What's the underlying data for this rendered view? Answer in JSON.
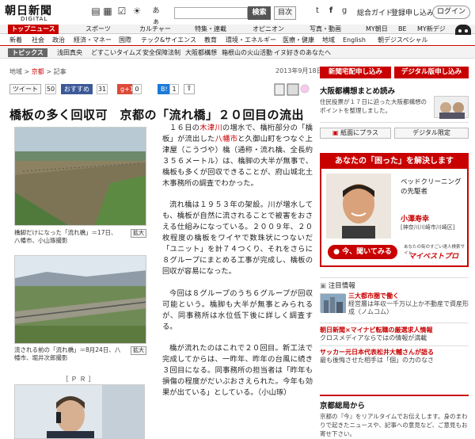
{
  "header": {
    "logo_main": "朝日新聞",
    "logo_sub": "DIGITAL",
    "search_button": "検索",
    "index_button": "目次",
    "guide_link": "総合ガイド",
    "register_link": "登録申し込み",
    "login_button": "ログイン",
    "font_size_label": "あぁ"
  },
  "nav1": {
    "items": [
      "トップニュース",
      "スポーツ",
      "カルチャー",
      "特集・連載",
      "オピニオン",
      "写真・動画",
      "MY朝日",
      "BE",
      "MY新デジ"
    ]
  },
  "nav2": {
    "items": [
      "新着",
      "社会",
      "政治",
      "経済・マネー",
      "国際",
      "テック&サイエンス",
      "教育",
      "環境・エネルギー",
      "医療・健康",
      "地域",
      "English",
      "朝デジスペシャル"
    ]
  },
  "topics": {
    "label": "トピックス",
    "items": [
      "浅田真央",
      "どすこいタイムズ",
      "安全保障法制",
      "大阪都構想",
      "箱根山の火山活動",
      "イヌ好きのあなたへ"
    ]
  },
  "breadcrumb": {
    "a": "地域",
    "b": "京都",
    "c": "記事",
    "sep": ">"
  },
  "date": "2013年9月18日",
  "social": {
    "tweet": "ツイート",
    "tweet_count": "50",
    "like": "おすすめ",
    "like_count": "31",
    "gplus": "g+1",
    "gplus_count": "0",
    "b": "B!",
    "b_count": "1"
  },
  "article": {
    "title": "橋板の多く回収可　京都の「流れ橋」２０回目の流出",
    "caption1": "橋脚だけになった「流れ橋」＝17日、八幡市、小山琢撮影",
    "caption2": "流される前の「流れ橋」＝8月24日、八幡市、堀井次郎撮影",
    "enlarge": "拡大",
    "p1a": "１６日の",
    "p1b": "木津川",
    "p1c": "の増水で、橋桁部分の「橋板」が流出した",
    "p1d": "八幡市",
    "p1e": "と久御山町をつなぐ上津屋（こうづや）橋（通称・流れ橋、全長約３５６メートル）は、橋脚の大半が無事で、橋板も多くが回収できることが、府山城北土木事務所の調査でわかった。",
    "p2": "流れ橋は１９５３年の架設。川が増水しても、橋板が自然に流されることで被害をおさえる仕組みになっている。２００９年、２０枚程度の橋板をワイヤで数珠状につないだ「ユニット」を計７４つくり、それをさらに８グループにまとめる工事が完成し、橋板の回収が容易になった。",
    "p3": "今回は８グループのうち６グループが回収可能という。橋脚も大半が無事とみられるが、同事務所は水位低下後に詳しく調査する。",
    "p4": "橋が流れたのはこれで２０回目。新工法で完成してからは、一昨年、昨年の台風に続き３回目になる。同事務所の担当者は「昨年も損傷の程度がだいぶおさえられた。今年も効果が出ている」としている。（小山琢）",
    "pr": "［ＰＲ］"
  },
  "right": {
    "btn_apply": "新聞宅配申し込み",
    "btn_digital": "デジタル版申し込み",
    "osaka_title": "大阪都構想まとめ読み",
    "osaka_text": "住民投票が１７日に迫った大阪都構想のポイントを整理しました。",
    "btn_paperplus": "紙面にプラス",
    "btn_limited": "デジタル限定",
    "ad_title": "あなたの「困った」を解決します",
    "ad_line1": "ベッドクリーニング",
    "ad_line2": "の先駆者",
    "ad_name": "小澤寿幸",
    "ad_region": "[神奈川川崎市川崎区]",
    "ad_cta": "今、聞いてみる",
    "ad_sponsor": "あなたの街のすごい達人検索サイト",
    "ad_brand": "マイベストプロ",
    "focus_label": "注目情報",
    "f1_head": "三大都市圏で働く",
    "f1_text": "経営層は年収一千万以上か不動産で資産形成〈ノムコム〉",
    "m1_head": "朝日新聞×マイナビ転職の厳選求人情報",
    "m1_text": "クロスメディアならではの情報が満載",
    "m2_head": "サッカー元日本代表松井大輔さんが語る",
    "m2_text": "最も後悔させた相手は「個」の力のなさ",
    "news_title": "京都総局から",
    "news_text": "京都の『今』をリアルタイムでお伝えします。身のまわりで起きたニュースや、記事への意見など、ご意見もお寄せ下さい。"
  },
  "colors": {
    "accent": "#c90000"
  }
}
